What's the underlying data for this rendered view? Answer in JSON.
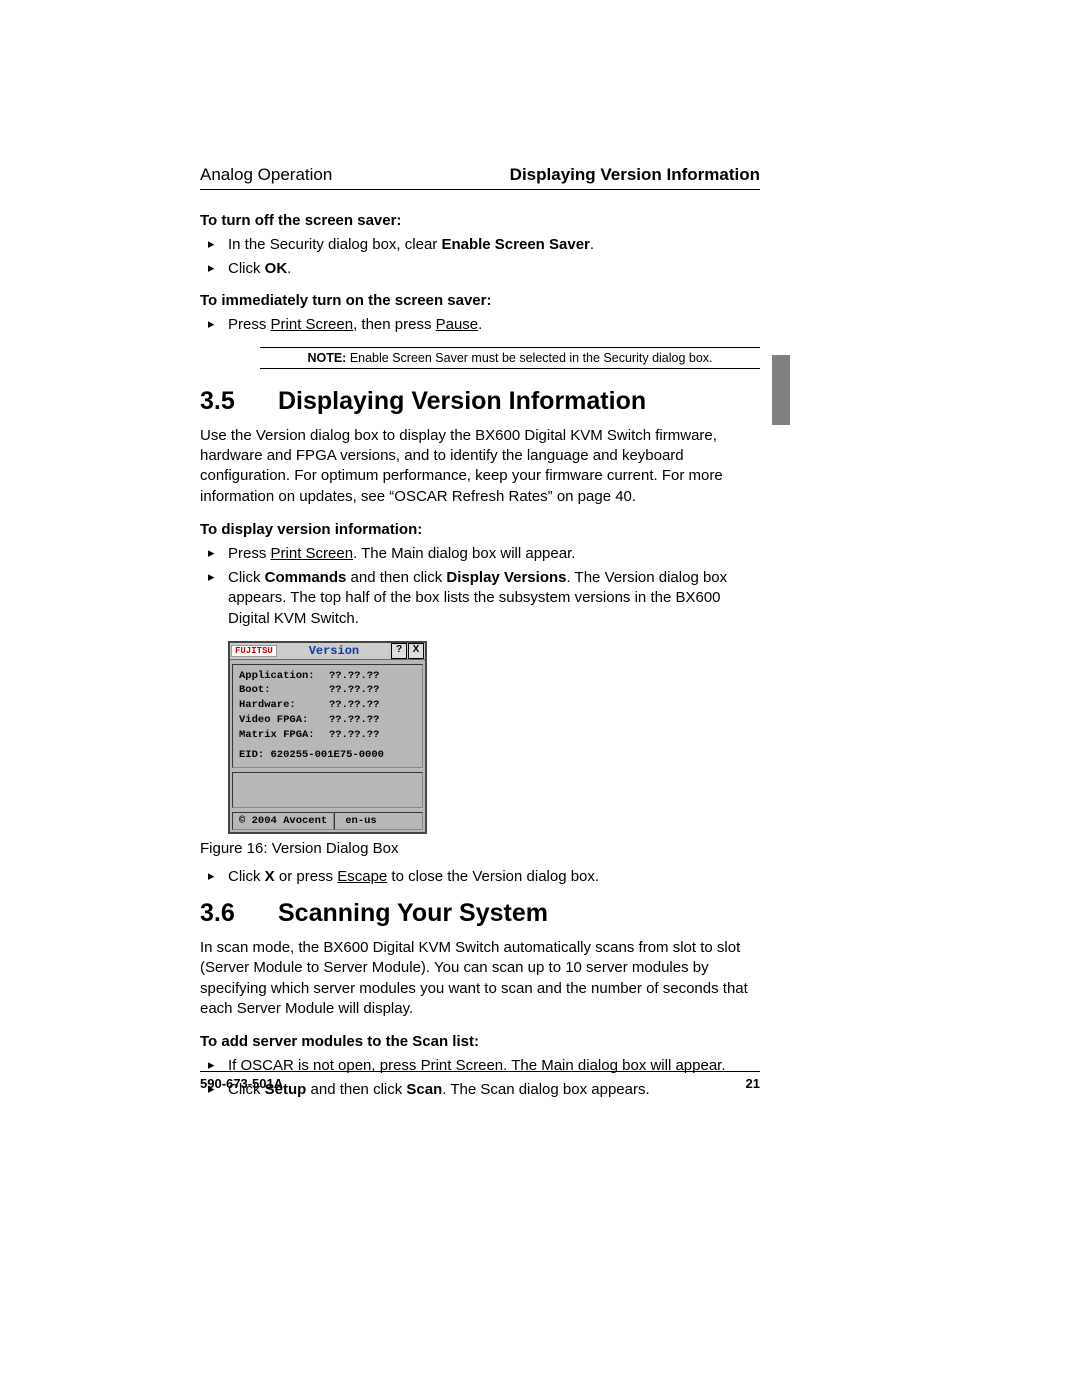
{
  "header": {
    "left": "Analog Operation",
    "right": "Displaying Version Information"
  },
  "s_off": {
    "title": "To turn off the screen saver:",
    "b1a": "In the Security dialog box, clear ",
    "b1b": "Enable Screen Saver",
    "b1c": ".",
    "b2a": "Click ",
    "b2b": "OK",
    "b2c": "."
  },
  "s_on": {
    "title": "To immediately turn on the screen saver:",
    "b1a": "Press ",
    "b1b": "Print Screen",
    "b1c": ", then press ",
    "b1d": "Pause",
    "b1e": "."
  },
  "note": {
    "label": "NOTE:",
    "text": " Enable Screen Saver must be selected in the Security dialog box."
  },
  "sec35": {
    "num": "3.5",
    "title": "Displaying Version Information",
    "para": "Use the Version dialog box to display the BX600 Digital KVM Switch firmware, hardware and FPGA versions, and to identify the language and keyboard configuration. For optimum performance, keep your firmware current. For more information on updates, see “OSCAR Refresh Rates” on page 40."
  },
  "disp": {
    "title": "To display version information:",
    "b1a": "Press ",
    "b1b": "Print Screen",
    "b1c": ". The Main dialog box will appear.",
    "b2a": "Click ",
    "b2b": "Commands",
    "b2c": " and then click ",
    "b2d": "Display Versions",
    "b2e": ". The Version dialog box appears. The top half of the box lists the subsystem versions in the BX600 Digital KVM Switch."
  },
  "dialog": {
    "logo": "FUJITSU",
    "title": "Version",
    "help": "?",
    "close": "X",
    "rows": [
      {
        "k": "Application:",
        "v": "??.??.??"
      },
      {
        "k": "Boot:",
        "v": "??.??.??"
      },
      {
        "k": "Hardware:",
        "v": "??.??.??"
      },
      {
        "k": "Video FPGA:",
        "v": "??.??.??"
      },
      {
        "k": "Matrix FPGA:",
        "v": "??.??.??"
      }
    ],
    "eid": "EID:  620255-001E75-0000",
    "copyright": "© 2004 Avocent",
    "lang": "en-us"
  },
  "fig": "Figure 16:  Version Dialog Box",
  "close_step": {
    "a": "Click ",
    "b": "X",
    "c": " or press ",
    "d": "Escape",
    "e": " to close the Version dialog box."
  },
  "sec36": {
    "num": "3.6",
    "title": "Scanning Your System",
    "para": "In scan mode, the BX600 Digital KVM Switch automatically scans from slot to slot (Server Module to Server Module). You can scan up to 10 server modules by specifying which server modules you want to scan and the number of seconds that each Server Module will display."
  },
  "scan": {
    "title": "To add server modules to the Scan list:",
    "b1a": "If OSCAR is not open, press ",
    "b1b": "Print Screen",
    "b1c": ". The Main dialog box will appear.",
    "b2a": "Click ",
    "b2b": "Setup",
    "b2c": " and then click ",
    "b2d": "Scan",
    "b2e": ". The Scan dialog box appears."
  },
  "footer": {
    "left": "590-673-501A",
    "right": "21"
  }
}
